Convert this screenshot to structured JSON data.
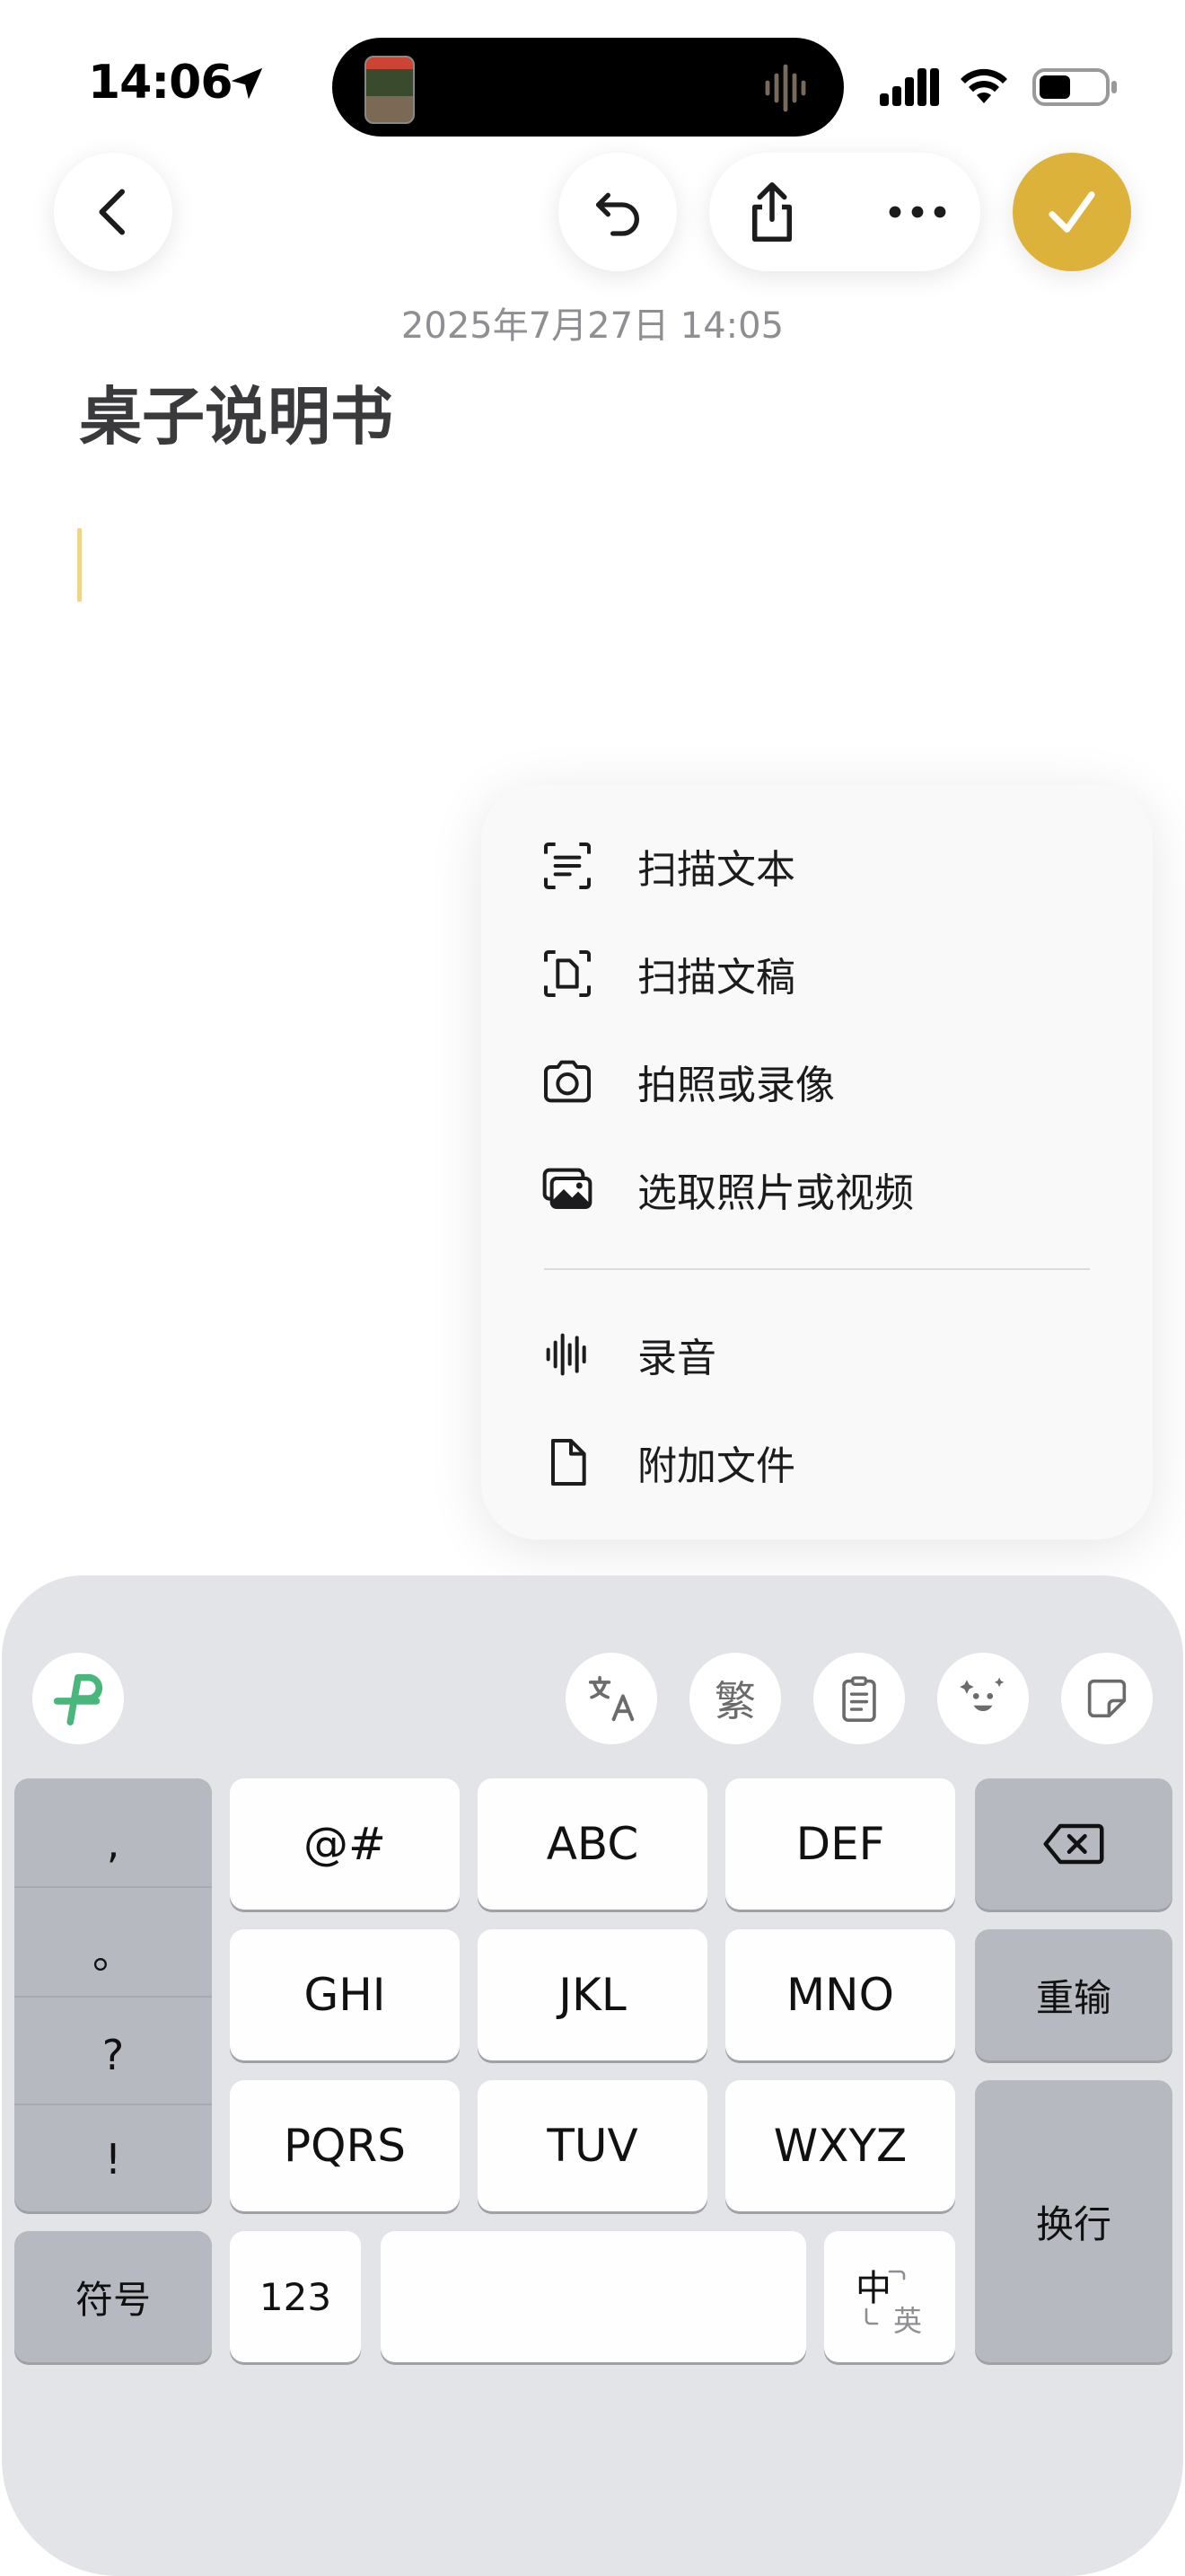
{
  "status_bar": {
    "time": "14:06"
  },
  "note": {
    "timestamp": "2025年7月27日 14:05",
    "title": "桌子说明书"
  },
  "colors": {
    "accent": "#ddb23a",
    "keyboard_bg": "#e3e4e8",
    "dark_key": "#b6b9c0"
  },
  "menu": {
    "items": [
      {
        "label": "扫描文本",
        "icon": "scan-text-icon"
      },
      {
        "label": "扫描文稿",
        "icon": "scan-document-icon"
      },
      {
        "label": "拍照或录像",
        "icon": "camera-icon"
      },
      {
        "label": "选取照片或视频",
        "icon": "photo-library-icon"
      },
      {
        "label": "录音",
        "icon": "waveform-icon"
      },
      {
        "label": "附加文件",
        "icon": "document-icon"
      }
    ]
  },
  "keyboard": {
    "toolbar": {
      "traditional": "繁"
    },
    "punctuation": [
      ",",
      "。",
      "?",
      "!"
    ],
    "symbols": "符号",
    "keys": {
      "at": "@#",
      "abc": "ABC",
      "def": "DEF",
      "ghi": "GHI",
      "jkl": "JKL",
      "mno": "MNO",
      "pqrs": "PQRS",
      "tuv": "TUV",
      "wxyz": "WXYZ",
      "num": "123",
      "space": "",
      "retype": "重输",
      "newline": "换行",
      "lang_main": "中",
      "lang_sub": "英"
    }
  }
}
